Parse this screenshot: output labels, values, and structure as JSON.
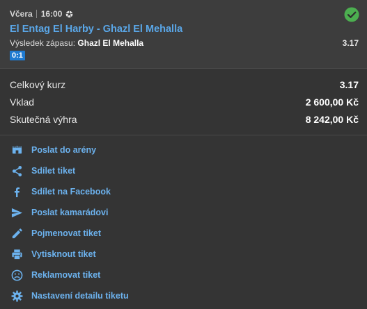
{
  "ticket": {
    "day": "Včera",
    "time": "16:00",
    "sport_icon": "soccer-ball-icon",
    "status_icon": "check-circle-icon",
    "status_color": "#4caf50",
    "match": "El Entag El Harby - Ghazl El Mehalla",
    "result_label": "Výsledek zápasu:",
    "result_pick": "Ghazl El Mehalla",
    "odd": "3.17",
    "score": "0:1"
  },
  "summary": [
    {
      "label": "Celkový kurz",
      "value": "3.17"
    },
    {
      "label": "Vklad",
      "value": "2 600,00 Kč"
    },
    {
      "label": "Skutečná výhra",
      "value": "8 242,00 Kč"
    }
  ],
  "actions": [
    {
      "label": "Poslat do arény",
      "icon": "arena-icon"
    },
    {
      "label": "Sdílet tiket",
      "icon": "share-icon"
    },
    {
      "label": "Sdílet na Facebook",
      "icon": "facebook-icon"
    },
    {
      "label": "Poslat kamarádovi",
      "icon": "send-icon"
    },
    {
      "label": "Pojmenovat tiket",
      "icon": "pencil-icon"
    },
    {
      "label": "Vytisknout tiket",
      "icon": "print-icon"
    },
    {
      "label": "Reklamovat tiket",
      "icon": "sad-face-icon"
    },
    {
      "label": "Nastavení detailu tiketu",
      "icon": "gear-icon"
    }
  ],
  "colors": {
    "background": "#343434",
    "header_background": "#3d3d3d",
    "link": "#6cb2ee",
    "match_link": "#5aa7e8",
    "score_badge": "#1f7ad0"
  }
}
